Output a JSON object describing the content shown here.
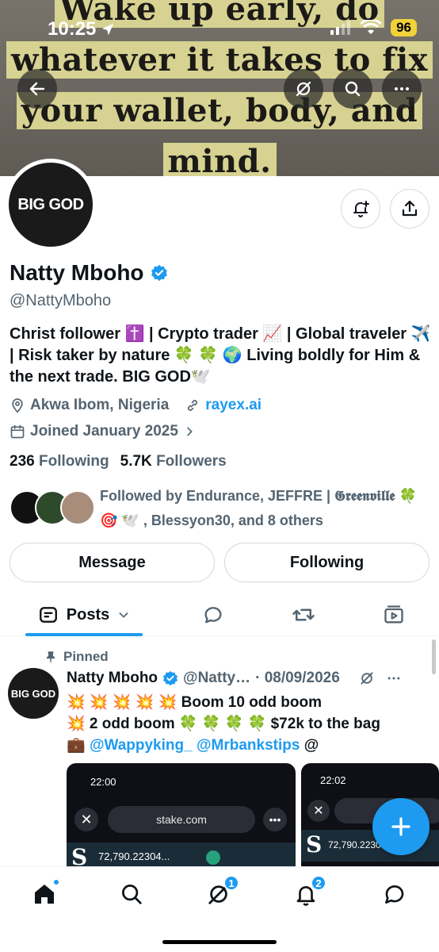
{
  "status_bar": {
    "time": "10:25",
    "battery": "96"
  },
  "banner": {
    "lines": [
      "Wake up early, do",
      "whatever it takes to fix",
      "your wallet, body, and",
      "mind."
    ]
  },
  "profile": {
    "avatar_text": "BIG GOD",
    "name": "Natty Mboho",
    "handle": "@NattyMboho",
    "bio": "Christ follower ✝️ | Crypto trader 📈 | Global traveler ✈️ | Risk taker by nature 🍀 🍀 🌍 Living boldly for Him & the next trade. BIG GOD🕊️",
    "location": "Akwa Ibom, Nigeria",
    "website": "rayex.ai",
    "joined": "Joined January 2025",
    "following_count": "236",
    "following_label": "Following",
    "followers_count": "5.7K",
    "followers_label": "Followers",
    "followed_by": "Followed by Endurance, JEFFRE | 𝕲𝖗𝖊𝖊𝖓𝖛𝖎𝖑𝖑𝖊 🍀 🎯 🕊️ , Blessyon30, and 8 others"
  },
  "actions": {
    "message": "Message",
    "following": "Following"
  },
  "tabs": {
    "posts": "Posts"
  },
  "post": {
    "pinned_label": "Pinned",
    "avatar_text": "BIG GOD",
    "author": "Natty Mboho",
    "handle": "@Natty…",
    "date": "· 08/09/2026",
    "line1": "💥 💥 💥 💥 💥 Boom 10 odd boom",
    "line2": "💥 2 odd boom 🍀 🍀 🍀 🍀 $72k to the bag",
    "line3_prefix": "💼",
    "mention1": "@Wappyking_",
    "mention2": "@Mrbankstips",
    "line3_suffix": "@",
    "shot1": {
      "time": "22:00",
      "url": "stake.com",
      "balance": "72,790.22304..."
    },
    "shot2": {
      "time": "22:02",
      "balance": "72,790.2230"
    }
  },
  "nav": {
    "messages_badge": "1",
    "notifications_badge": "2"
  },
  "colors": {
    "accent": "#1d9bf0",
    "text": "#0f1419",
    "secondary": "#536471"
  }
}
